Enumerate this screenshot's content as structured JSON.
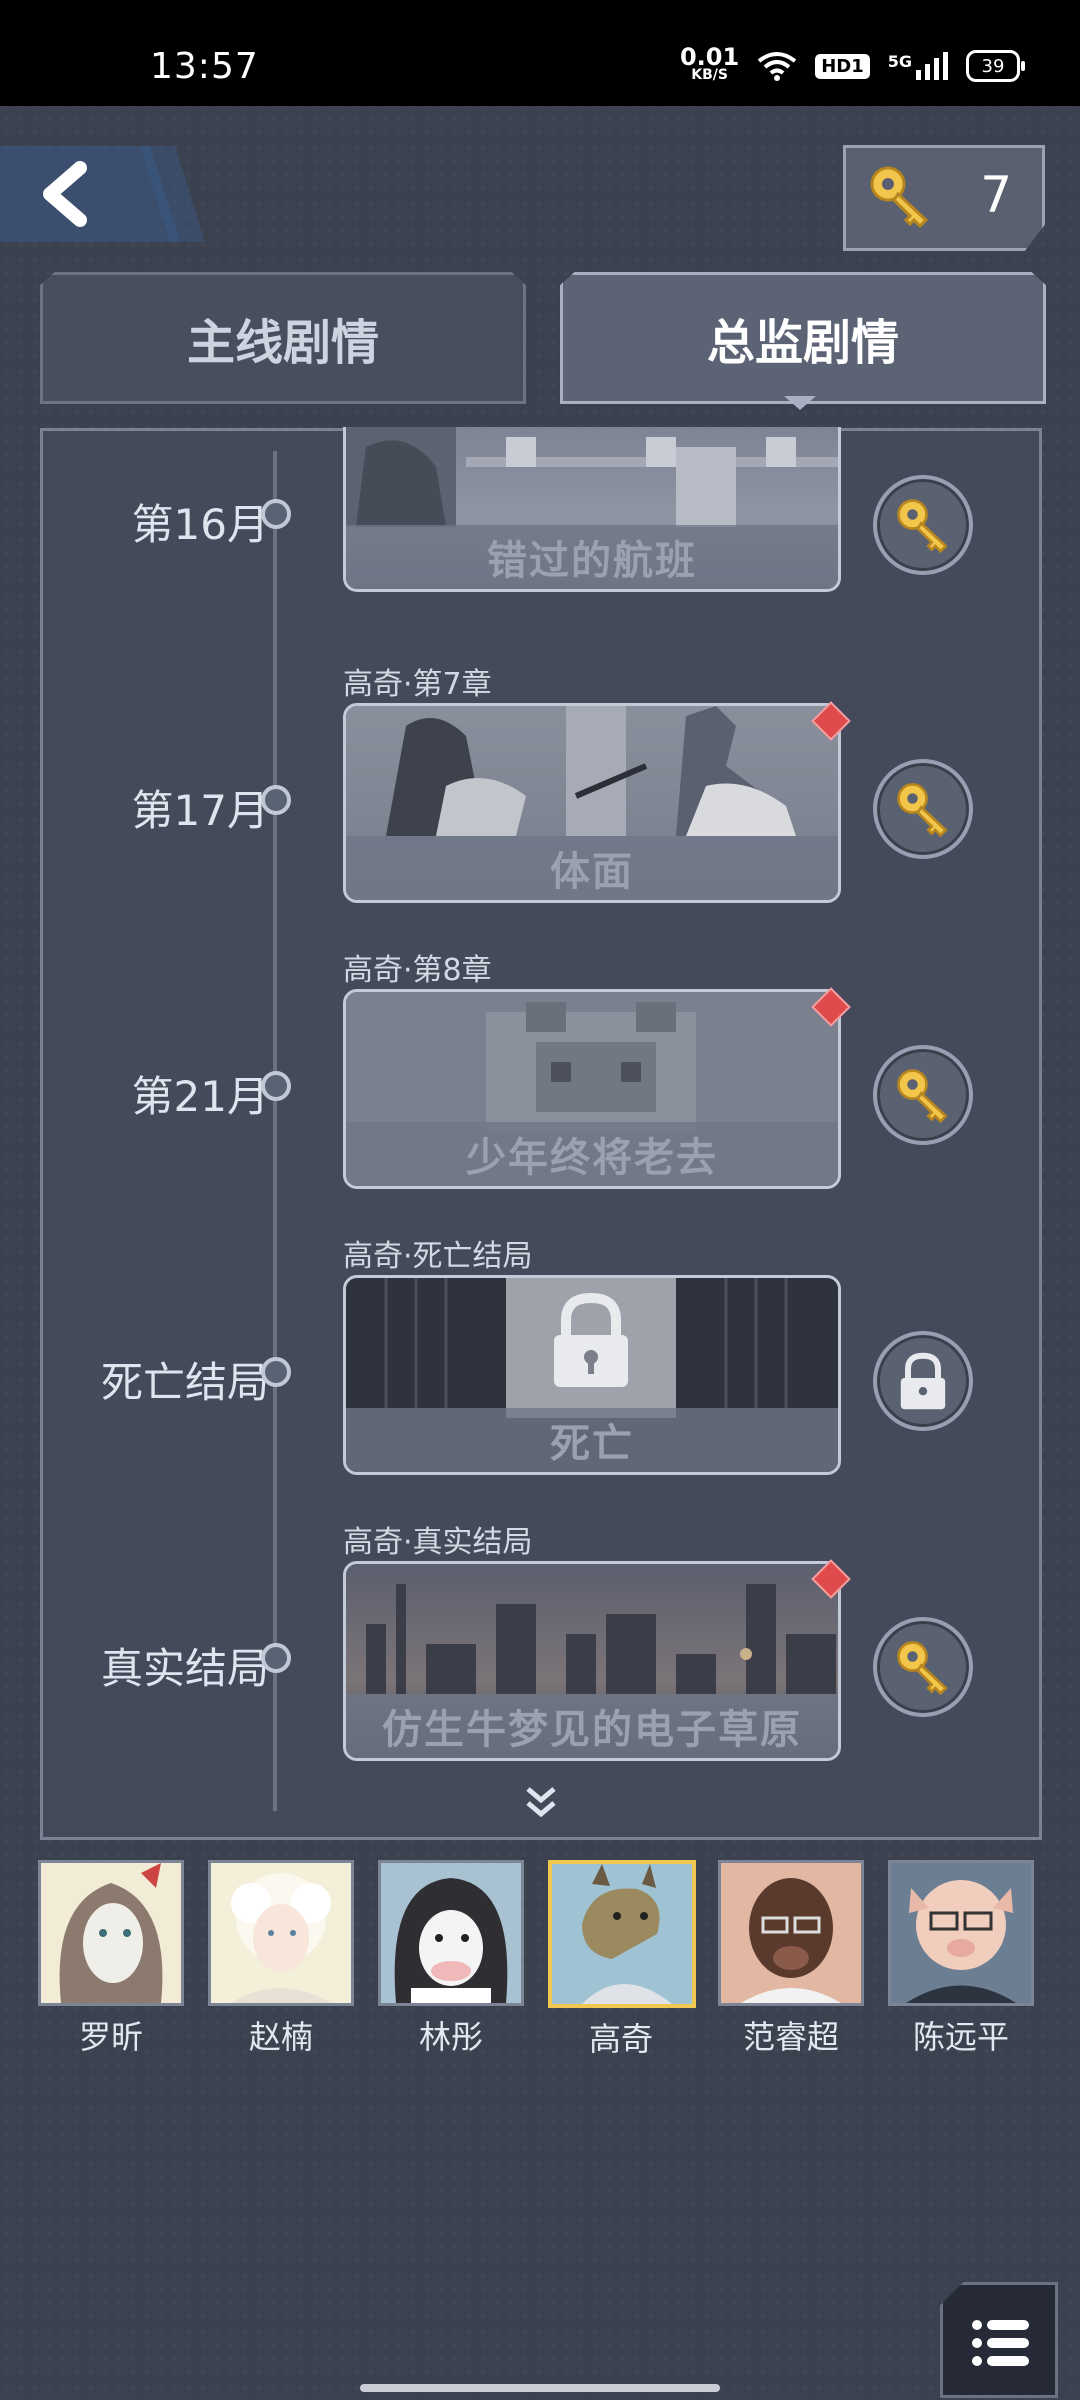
{
  "status_bar": {
    "time": "13:57",
    "net_speed_value": "0.01",
    "net_speed_unit": "KB/S",
    "hd_badge": "HD1",
    "network": "5G",
    "battery": "39"
  },
  "header": {
    "key_count": "7"
  },
  "tabs": [
    {
      "label": "主线剧情",
      "selected": false
    },
    {
      "label": "总监剧情",
      "selected": true
    }
  ],
  "timeline": [
    {
      "month": "第16月",
      "chapter": "",
      "title": "错过的航班",
      "is_new": false,
      "locked": false
    },
    {
      "month": "第17月",
      "chapter": "高奇·第7章",
      "title": "体面",
      "is_new": true,
      "locked": false
    },
    {
      "month": "第21月",
      "chapter": "高奇·第8章",
      "title": "少年终将老去",
      "is_new": true,
      "locked": false
    },
    {
      "month": "死亡结局",
      "chapter": "高奇·死亡结局",
      "title": "死亡",
      "is_new": false,
      "locked": true
    },
    {
      "month": "真实结局",
      "chapter": "高奇·真实结局",
      "title": "仿生牛梦见的电子草原",
      "is_new": true,
      "locked": false
    }
  ],
  "characters": [
    {
      "name": "罗昕",
      "selected": false
    },
    {
      "name": "赵楠",
      "selected": false
    },
    {
      "name": "林彤",
      "selected": false
    },
    {
      "name": "高奇",
      "selected": true
    },
    {
      "name": "范睿超",
      "selected": false
    },
    {
      "name": "陈远平",
      "selected": false
    }
  ],
  "colors": {
    "accent_gold": "#f0c850",
    "new_marker": "#e04a4a"
  }
}
